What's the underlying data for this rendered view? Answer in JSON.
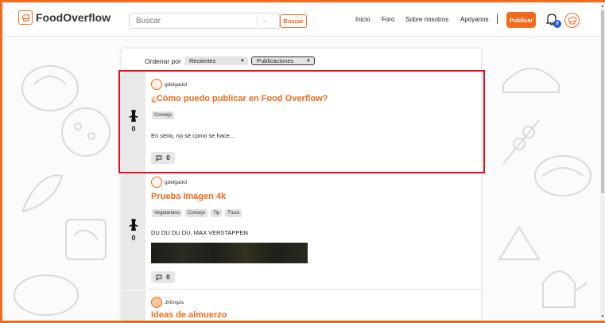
{
  "app": {
    "name": "FoodOverflow"
  },
  "search": {
    "placeholder": "Buscar",
    "button": "Buscar"
  },
  "nav": {
    "items": [
      "Inicio",
      "Foro",
      "Sobre nosotros",
      "Apóyanos"
    ],
    "publish": "Publicar",
    "notifications_count": "0"
  },
  "sort": {
    "label": "Ordenar por",
    "order_value": "Recientes",
    "type_value": "Publicaciones"
  },
  "posts": [
    {
      "author": "gdelgadol",
      "title": "¿Cómo puedo publicar en Food Overflow?",
      "tags": [
        "Consejo"
      ],
      "body": "En serio, no sé como se hace...",
      "votes": "0",
      "comments": "0"
    },
    {
      "author": "gdelgadol",
      "title": "Prueba Imagen 4k",
      "tags": [
        "Vegetariano",
        "Consejo",
        "Tip",
        "Truco"
      ],
      "body": "DU DU DU DU, MAX VERSTAPPEN",
      "votes": "0",
      "comments": "0"
    },
    {
      "author": "Jh0mpis",
      "title": "Ideas de almuerzo"
    }
  ],
  "colors": {
    "accent": "#f26a1b",
    "highlight": "#e01020",
    "badge": "#2355d8"
  }
}
